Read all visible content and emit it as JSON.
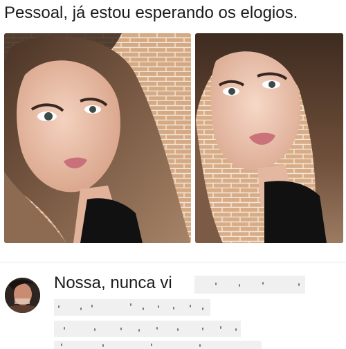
{
  "post": {
    "text": "Pessoal, já estou esperando os elogios."
  },
  "photos": {
    "left_alt": "selfie-photo-left",
    "right_alt": "selfie-photo-right"
  },
  "comment": {
    "visible_text": "Nossa, nunca vi"
  },
  "colors": {
    "background": "#ffffff",
    "text": "#1b1b1b",
    "divider": "#e4e6ea",
    "redaction": "#f0f0f0"
  },
  "icons": [
    "avatar-image"
  ]
}
